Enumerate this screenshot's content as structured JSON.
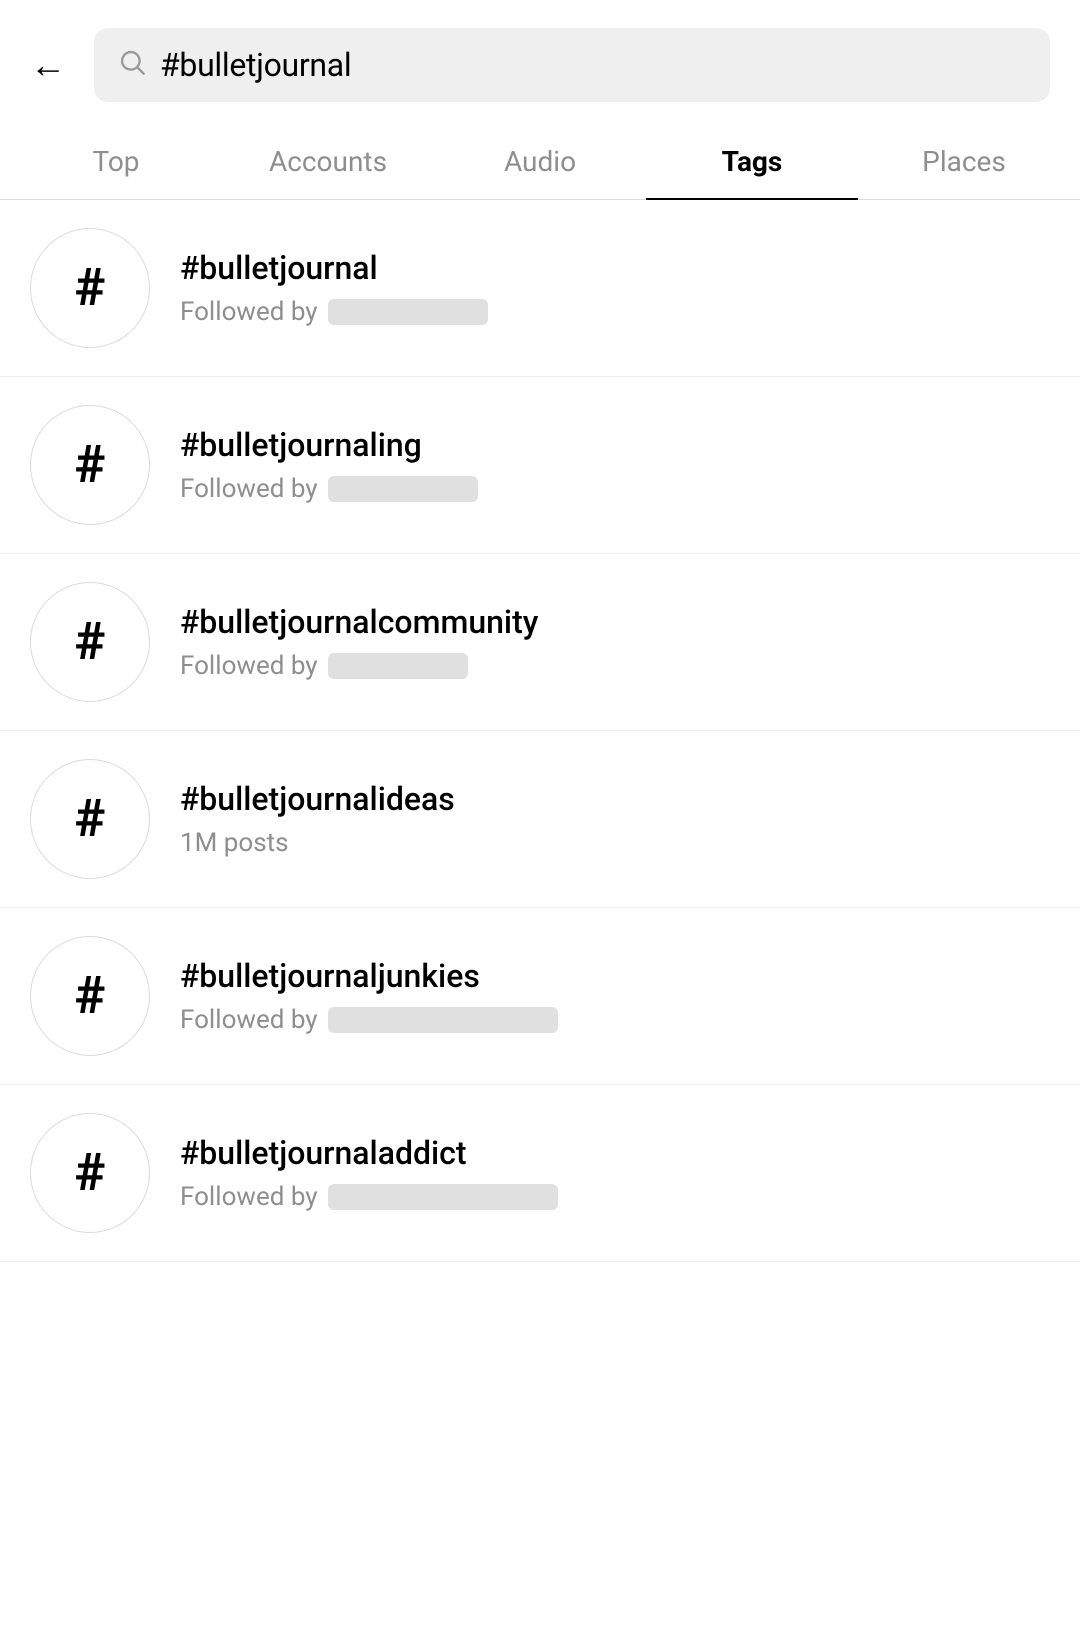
{
  "header": {
    "back_label": "←",
    "search_value": "#bulletjournal"
  },
  "tabs": [
    {
      "id": "top",
      "label": "Top",
      "active": false
    },
    {
      "id": "accounts",
      "label": "Accounts",
      "active": false
    },
    {
      "id": "audio",
      "label": "Audio",
      "active": false
    },
    {
      "id": "tags",
      "label": "Tags",
      "active": true
    },
    {
      "id": "places",
      "label": "Places",
      "active": false
    }
  ],
  "tags": [
    {
      "name": "#bulletjournal",
      "sub_type": "followed_by",
      "followed_by_text": "Followed by",
      "placeholder_width": 160
    },
    {
      "name": "#bulletjournaling",
      "sub_type": "followed_by",
      "followed_by_text": "Followed by",
      "placeholder_width": 150
    },
    {
      "name": "#bulletjournalcommunity",
      "sub_type": "followed_by",
      "followed_by_text": "Followed by",
      "placeholder_width": 140
    },
    {
      "name": "#bulletjournalideas",
      "sub_type": "posts",
      "posts_text": "1M posts"
    },
    {
      "name": "#bulletjournaljunkies",
      "sub_type": "followed_by",
      "followed_by_text": "Followed by",
      "placeholder_width": 230
    },
    {
      "name": "#bulletjournaladdict",
      "sub_type": "followed_by",
      "followed_by_text": "Followed by",
      "placeholder_width": 230
    }
  ]
}
